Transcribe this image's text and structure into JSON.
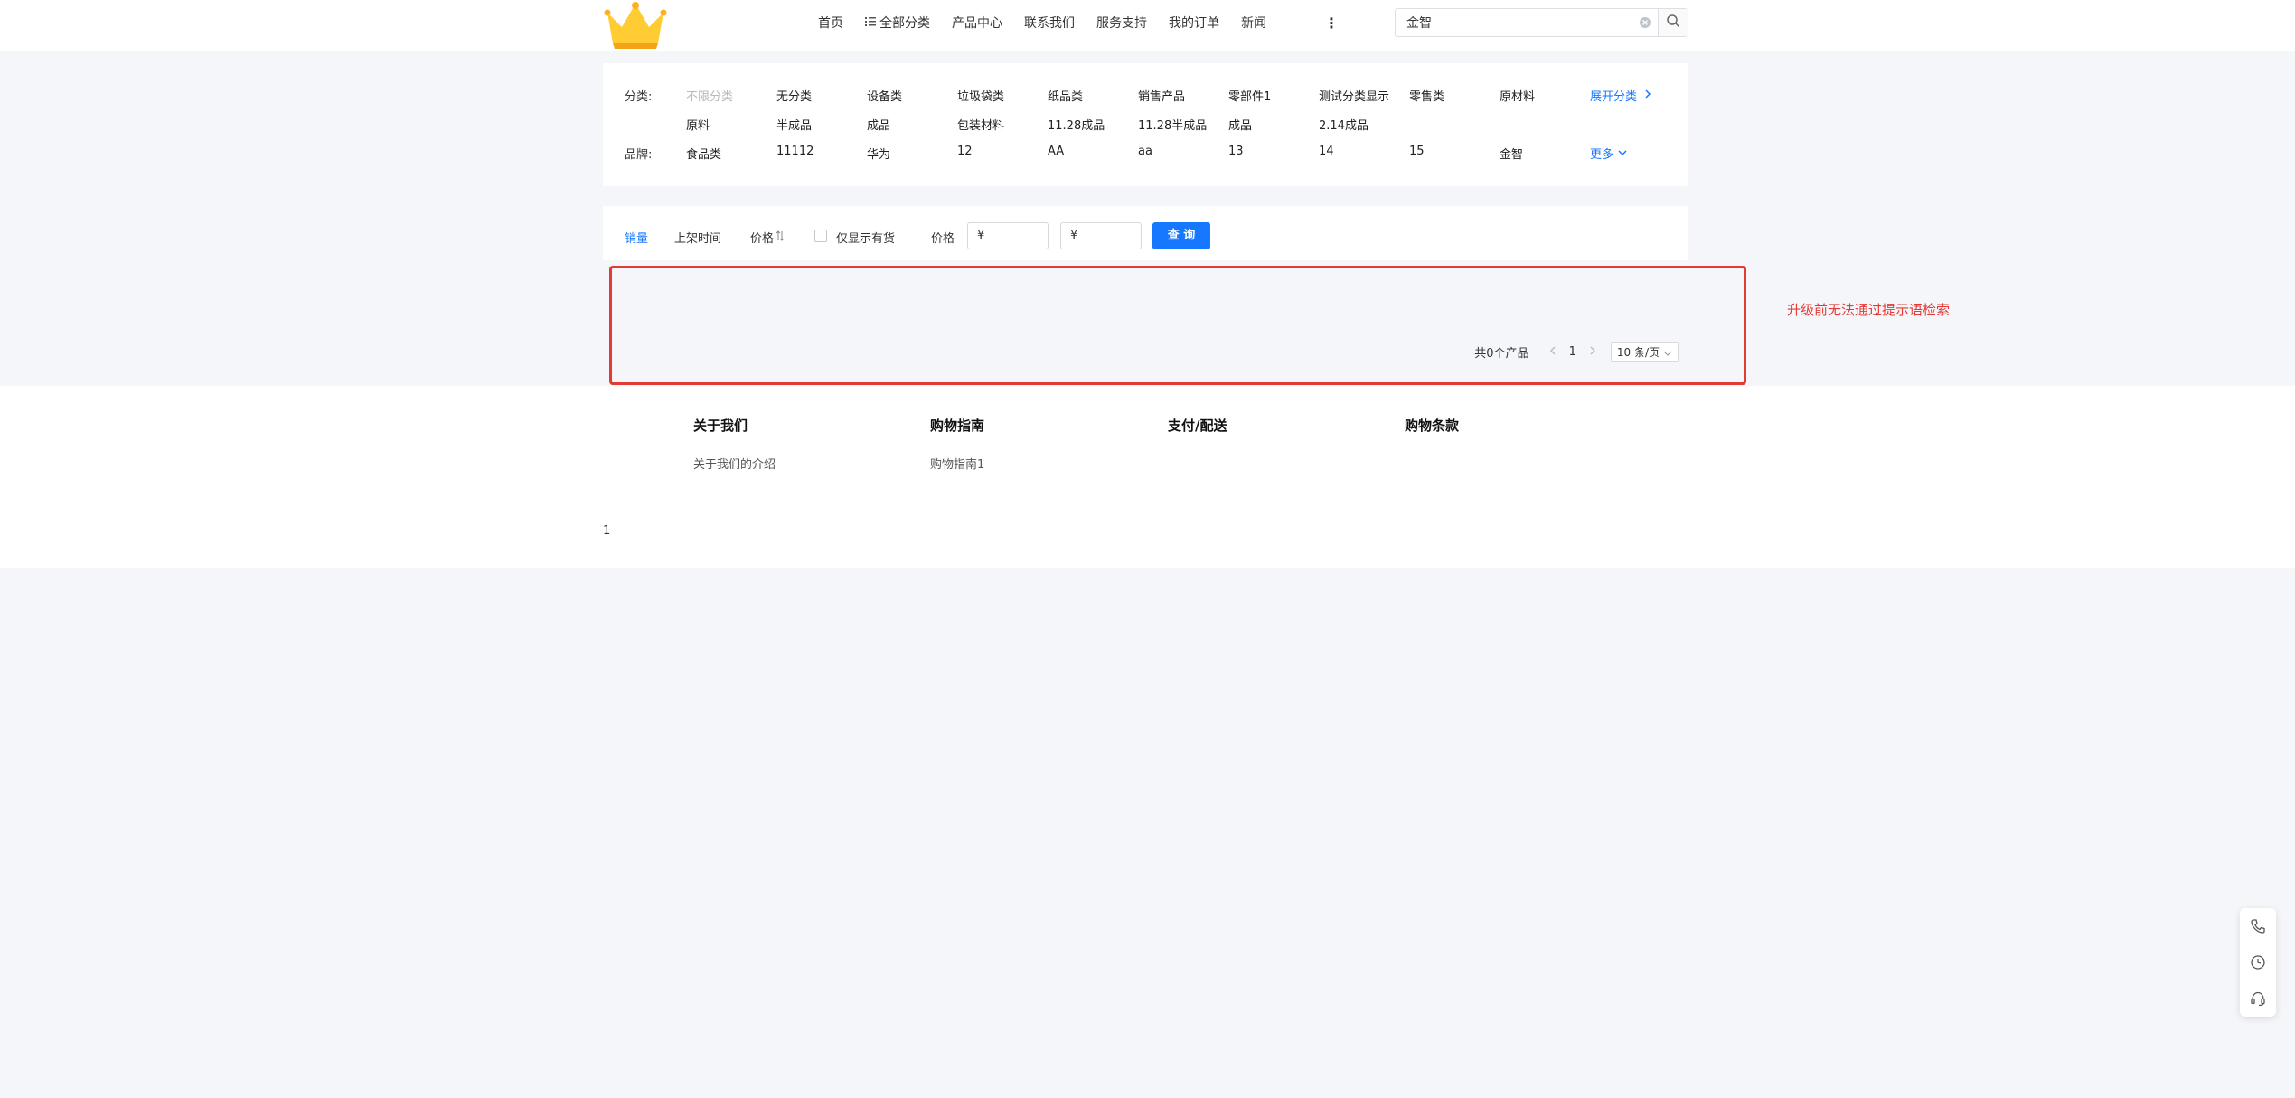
{
  "nav": {
    "items": [
      "首页",
      "全部分类",
      "产品中心",
      "联系我们",
      "服务支持",
      "我的订单",
      "新闻"
    ],
    "more": "⋮"
  },
  "search": {
    "value": "金智"
  },
  "filters": {
    "category_label": "分类:",
    "categories_row1": [
      "不限分类",
      "无分类",
      "设备类",
      "垃圾袋类",
      "纸品类",
      "销售产品",
      "零部件1",
      "测试分类显示",
      "零售类",
      "原材料"
    ],
    "categories_row2": [
      "原料",
      "半成品",
      "成品",
      "包装材料",
      "11.28成品",
      "11.28半成品",
      "成品",
      "2.14成品"
    ],
    "expand_label": "展开分类",
    "brand_label": "品牌:",
    "brands": [
      "食品类",
      "11112",
      "华为",
      "12",
      "AA",
      "aa",
      "13",
      "14",
      "15",
      "金智"
    ],
    "more_label": "更多"
  },
  "sort": {
    "sales": "销量",
    "time": "上架时间",
    "price": "价格",
    "instock": "仅显示有货",
    "price_label": "价格",
    "min_placeholder": "¥",
    "max_placeholder": "¥",
    "query": "查 询"
  },
  "result": {
    "total": "共0个产品",
    "page": "1",
    "page_size": "10 条/页"
  },
  "note": "升级前无法通过提示语检索",
  "footer": {
    "columns": [
      {
        "title": "关于我们",
        "link": "关于我们的介绍"
      },
      {
        "title": "购物指南",
        "link": "购物指南1"
      },
      {
        "title": "支付/配送",
        "link": ""
      },
      {
        "title": "购物条款",
        "link": ""
      }
    ],
    "copyright": "1"
  },
  "colors": {
    "accent": "#1677ff",
    "highlight": "#e53935",
    "bg": "#f5f6f9"
  }
}
